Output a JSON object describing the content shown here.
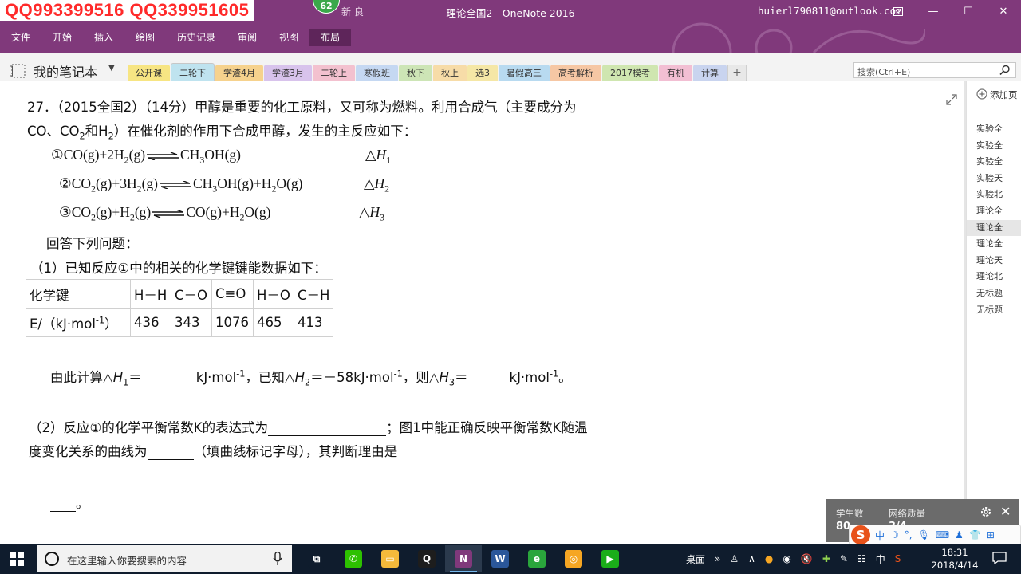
{
  "overlay": {
    "watermark": "QQ993399516  QQ339951605",
    "badge_count": "62",
    "qa_hint": "新 良"
  },
  "window": {
    "title": "理论全国2 - OneNote 2016",
    "account": "huierl790811@outlook.com",
    "minimize": "—",
    "maximize": "☐",
    "close": "✕"
  },
  "ribbon": {
    "tabs": [
      {
        "label": "文件"
      },
      {
        "label": "开始"
      },
      {
        "label": "插入"
      },
      {
        "label": "绘图"
      },
      {
        "label": "历史记录"
      },
      {
        "label": "审阅"
      },
      {
        "label": "视图"
      },
      {
        "label": "布局",
        "active": true
      }
    ]
  },
  "notebook": {
    "title": "我的笔记本",
    "caret": "▼",
    "sections": [
      {
        "label": "公开课",
        "color": "#f7e583"
      },
      {
        "label": "二轮下",
        "color": "#bfe3ef",
        "active": true
      },
      {
        "label": "学渣4月",
        "color": "#f6d28d"
      },
      {
        "label": "学渣3月",
        "color": "#d8c3ec"
      },
      {
        "label": "二轮上",
        "color": "#f3c1cf"
      },
      {
        "label": "寒假班",
        "color": "#c5d8f2"
      },
      {
        "label": "秋下",
        "color": "#cde5b6"
      },
      {
        "label": "秋上",
        "color": "#f7dca8"
      },
      {
        "label": "选3",
        "color": "#f5e7a6"
      },
      {
        "label": "暑假高三",
        "color": "#b8daf0"
      },
      {
        "label": "高考解析",
        "color": "#f6c7a4"
      },
      {
        "label": "2017模考",
        "color": "#cfe6b0"
      },
      {
        "label": "有机",
        "color": "#f2bfd3"
      },
      {
        "label": "计算",
        "color": "#c9d4ef"
      }
    ],
    "add_section": "+",
    "search_placeholder": "搜索(Ctrl+E)"
  },
  "content": {
    "line1": "27．（2015全国2）（14分）甲醇是重要的化工原料，又可称为燃料。利用合成气（主要成分为",
    "line2_a": "CO、CO",
    "line2_b": "2",
    "line2_c": "和H",
    "line2_d": "2",
    "line2_e": "）在催化剂的作用下合成甲醇，发生的主反应如下：",
    "r1_a": "①CO(g)+2H",
    "r1_b": "2",
    "r1_c": "(g)",
    "r1_d": "CH",
    "r1_e": "3",
    "r1_f": "OH(g)",
    "r2_a": "②CO",
    "r2_b": "2",
    "r2_c": "(g)+3H",
    "r2_d": "2",
    "r2_e": "(g)",
    "r2_f": "CH",
    "r2_g": "3",
    "r2_h": "OH(g)+H",
    "r2_i": "2",
    "r2_j": "O(g)",
    "r3_a": "③CO",
    "r3_b": "2",
    "r3_c": "(g)+H",
    "r3_d": "2",
    "r3_e": "(g)",
    "r3_f": "CO(g)+H",
    "r3_g": "2",
    "r3_h": "O(g)",
    "dh1_a": "△",
    "dh1_b": "H",
    "dh1_c": "1",
    "dh2_a": "△",
    "dh2_b": "H",
    "dh2_c": "2",
    "dh3_a": "△",
    "dh3_b": "H",
    "dh3_c": "3",
    "answer_intro": "回答下列问题：",
    "part1": "（1）已知反应①中的相关的化学键键能数据如下：",
    "table": {
      "head": [
        "化学键",
        "H－H",
        "C－O",
        "C≡O",
        "H－O",
        "C－H"
      ],
      "row_label_a": "E/（kJ·mol",
      "row_label_b": "-1",
      "row_label_c": "）",
      "values": [
        "436",
        "343",
        "1076",
        "465",
        "413"
      ]
    },
    "calc_a": "由此计算△",
    "calc_b": "H",
    "calc_c": "1",
    "calc_d": "＝",
    "calc_e": "kJ·mol",
    "calc_f": "-1",
    "calc_g": "，已知△",
    "calc_h": "H",
    "calc_i": "2",
    "calc_j": "＝－58kJ·mol",
    "calc_k": "-1",
    "calc_l": "，则△",
    "calc_m": "H",
    "calc_n": "3",
    "calc_o": "＝",
    "calc_p": "kJ·mol",
    "calc_q": "-1",
    "calc_r": "。",
    "part2_a": "（2）反应①的化学平衡常数K的表达式为",
    "part2_b": "；图1中能正确反映平衡常数K随温",
    "part2_c": "度变化关系的曲线为",
    "part2_d": "（填曲线标记字母），其判断理由是",
    "final_period": "。"
  },
  "pagelist": {
    "add_page": "添加页",
    "pages": [
      {
        "label": "实验全"
      },
      {
        "label": "实验全"
      },
      {
        "label": "实验全"
      },
      {
        "label": "实验天"
      },
      {
        "label": "实验北"
      },
      {
        "label": "理论全"
      },
      {
        "label": "理论全",
        "active": true
      },
      {
        "label": "理论全"
      },
      {
        "label": "理论天"
      },
      {
        "label": "理论北"
      },
      {
        "label": "无标题"
      },
      {
        "label": "无标题"
      }
    ]
  },
  "live": {
    "students_label": "学生数",
    "students_value": "80",
    "network_label": "网络质量",
    "network_value": "3/4",
    "close": "✕"
  },
  "ime": {
    "logo": "S",
    "lang": "中",
    "items": [
      "☽",
      "°,",
      "🎙",
      "⌨",
      "♟",
      "👕",
      "⊞"
    ]
  },
  "taskbar": {
    "search_placeholder": "在这里输入你要搜索的内容",
    "apps": [
      {
        "name": "task-view",
        "label": "⧉",
        "color": "#0f1c2d"
      },
      {
        "name": "wechat",
        "label": "✆",
        "color": "#2dc100"
      },
      {
        "name": "file-explorer",
        "label": "▭",
        "color": "#f3b93b"
      },
      {
        "name": "qq",
        "label": "Q",
        "color": "#1d1d1d"
      },
      {
        "name": "onenote",
        "label": "N",
        "color": "#80397b",
        "active": true
      },
      {
        "name": "word",
        "label": "W",
        "color": "#2b579a"
      },
      {
        "name": "browser",
        "label": "e",
        "color": "#2aa53c"
      },
      {
        "name": "media",
        "label": "◎",
        "color": "#f6a623"
      },
      {
        "name": "wechat-work",
        "label": "▶",
        "color": "#1aad19"
      }
    ],
    "tray_desktop": "桌面",
    "tray_more": "»",
    "tray_ime": "中",
    "time": "18:31",
    "date": "2018/4/14"
  }
}
